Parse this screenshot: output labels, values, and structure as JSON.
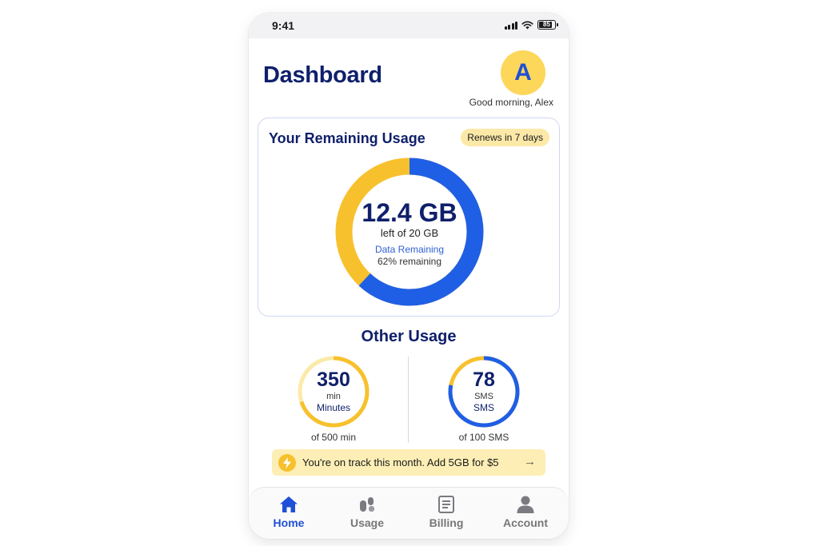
{
  "status_bar": {
    "time": "9:41",
    "battery": "85"
  },
  "header": {
    "title": "Dashboard",
    "avatar_letter": "A",
    "greeting": "Good morning, Alex"
  },
  "usage_card": {
    "title": "Your Remaining Usage",
    "renew_badge": "Renews in 7 days",
    "value": "12.4 GB",
    "subtitle": "left of 20 GB",
    "label": "Data Remaining",
    "percent_text": "62% remaining",
    "remaining_fraction": 0.62
  },
  "other_usage": {
    "title": "Other Usage",
    "minutes": {
      "value": "350",
      "unit": "min",
      "name": "Minutes",
      "of_text": "of 500 min",
      "fraction": 0.7
    },
    "sms": {
      "value": "78",
      "unit": "SMS",
      "name": "SMS",
      "of_text": "of 100 SMS",
      "fraction": 0.78
    }
  },
  "promo": {
    "text": "You're on track this month. Add 5GB for $5",
    "arrow": "→",
    "icon": "lightning-icon"
  },
  "tabs": [
    {
      "label": "Home",
      "icon": "home-icon",
      "active": true
    },
    {
      "label": "Usage",
      "icon": "usage-icon",
      "active": false
    },
    {
      "label": "Billing",
      "icon": "billing-icon",
      "active": false
    },
    {
      "label": "Account",
      "icon": "account-icon",
      "active": false
    }
  ],
  "colors": {
    "primary_blue": "#1f5fe6",
    "accent_yellow": "#f7c12e",
    "navy": "#0f1f6b",
    "track": "#fbeaa8"
  }
}
